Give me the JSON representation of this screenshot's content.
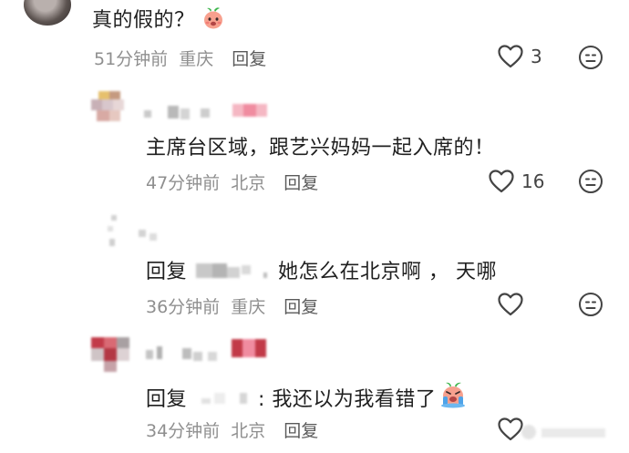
{
  "comments": [
    {
      "text": "真的假的？",
      "time": "51分钟前",
      "location": "重庆",
      "reply_label": "回复",
      "likes": "3",
      "emoji": "peach-face"
    },
    {
      "text": "主席台区域，跟艺兴妈妈一起入席的！",
      "time": "47分钟前",
      "location": "北京",
      "reply_label": "回复",
      "likes": "16"
    },
    {
      "reply_prefix": "回复",
      "text": "她怎么在北京啊 ， 天哪",
      "time": "36分钟前",
      "location": "重庆",
      "reply_label": "回复",
      "likes": ""
    },
    {
      "reply_prefix": "回复",
      "text": ": 我还以为我看错了",
      "time": "34分钟前",
      "location": "北京",
      "reply_label": "回复",
      "likes": "",
      "emoji": "crying-peach-face"
    }
  ],
  "colors": {
    "text": "#1f1f1f",
    "meta": "#8f8f8f",
    "icon": "#444444",
    "censor_pink": "#f08ca0",
    "censor_red": "#c23a48"
  }
}
